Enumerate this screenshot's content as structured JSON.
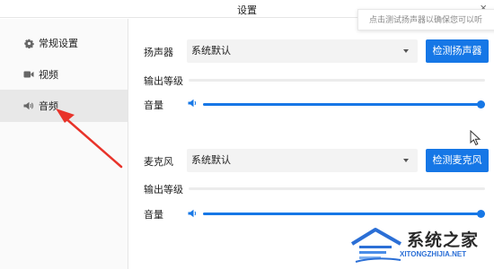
{
  "window": {
    "title": "设置",
    "close_glyph": "×"
  },
  "tooltip": {
    "text": "点击测试扬声器以确保您可以听"
  },
  "sidebar": {
    "items": [
      {
        "label": "常规设置",
        "icon": "gear-icon",
        "active": false
      },
      {
        "label": "视频",
        "icon": "video-camera-icon",
        "active": false
      },
      {
        "label": "音频",
        "icon": "speaker-icon",
        "active": true
      }
    ]
  },
  "speaker": {
    "label": "扬声器",
    "device": "系统默认",
    "test_button": "检测扬声器",
    "output_level_label": "输出等级",
    "volume_label": "音量",
    "volume_level": 1.0
  },
  "microphone": {
    "label": "麦克风",
    "device": "系统默认",
    "test_button": "检测麦克风",
    "output_level_label": "输出等级",
    "volume_label": "音量",
    "volume_level": 1.0
  },
  "watermark": {
    "title": "系统之家",
    "subtitle": "XITONGZHIJIA.NET"
  },
  "colors": {
    "accent": "#1677e6",
    "annotation_arrow": "#e8332a",
    "active_nav_bg": "#e8e8e8"
  }
}
